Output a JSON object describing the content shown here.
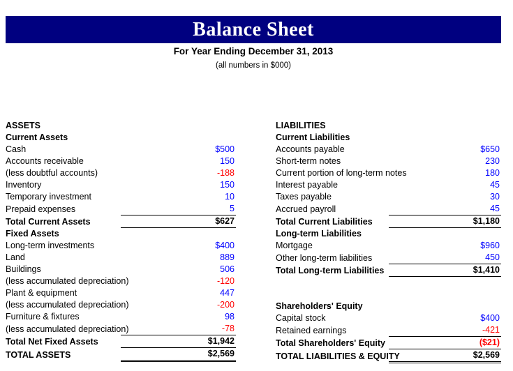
{
  "header": {
    "title": "Balance Sheet",
    "subtitle": "For Year Ending December 31, 2013",
    "units_note": "(all numbers in $000)",
    "banner_color": "#000080",
    "title_color": "#ffffff"
  },
  "colors": {
    "positive_value": "#0000ff",
    "negative_value": "#ff0000",
    "total_value": "#000000",
    "text": "#000000"
  },
  "assets": {
    "heading": "ASSETS",
    "sections": [
      {
        "name": "Current Assets",
        "rows": [
          {
            "label": "Cash",
            "value": "$500",
            "indent": 0,
            "bold": false,
            "color": "blue"
          },
          {
            "label": "Accounts receivable",
            "value": "150",
            "indent": 0,
            "bold": false,
            "color": "blue"
          },
          {
            "label": "(less doubtful accounts)",
            "value": "-188",
            "indent": 1,
            "bold": false,
            "color": "red"
          },
          {
            "label": "Inventory",
            "value": "150",
            "indent": 0,
            "bold": false,
            "color": "blue"
          },
          {
            "label": "Temporary investment",
            "value": "10",
            "indent": 0,
            "bold": false,
            "color": "blue"
          },
          {
            "label": "Prepaid expenses",
            "value": "5",
            "indent": 0,
            "bold": false,
            "color": "blue"
          },
          {
            "label": "Total Current Assets",
            "value": "$627",
            "indent": 2,
            "bold": true,
            "color": "black",
            "rule": "top-bottom"
          }
        ]
      },
      {
        "name": "Fixed Assets",
        "rows": [
          {
            "label": "Long-term investments",
            "value": "$400",
            "indent": 0,
            "bold": false,
            "color": "blue"
          },
          {
            "label": "Land",
            "value": "889",
            "indent": 0,
            "bold": false,
            "color": "blue"
          },
          {
            "label": "Buildings",
            "value": "506",
            "indent": 0,
            "bold": false,
            "color": "blue"
          },
          {
            "label": "(less accumulated depreciation)",
            "value": "-120",
            "indent": 1,
            "bold": false,
            "color": "red"
          },
          {
            "label": "Plant & equipment",
            "value": "447",
            "indent": 0,
            "bold": false,
            "color": "blue"
          },
          {
            "label": "(less accumulated depreciation)",
            "value": "-200",
            "indent": 1,
            "bold": false,
            "color": "red"
          },
          {
            "label": "Furniture & fixtures",
            "value": "98",
            "indent": 0,
            "bold": false,
            "color": "blue"
          },
          {
            "label": "(less accumulated depreciation)",
            "value": "-78",
            "indent": 1,
            "bold": false,
            "color": "red"
          },
          {
            "label": "Total Net Fixed Assets",
            "value": "$1,942",
            "indent": 2,
            "bold": true,
            "color": "black",
            "rule": "top-bottom"
          },
          {
            "label": "TOTAL ASSETS",
            "value": "$2,569",
            "indent": 0,
            "bold": true,
            "color": "black",
            "rule": "double"
          }
        ]
      }
    ]
  },
  "liabilities": {
    "heading": "LIABILITIES",
    "sections": [
      {
        "name": "Current Liabilities",
        "rows": [
          {
            "label": "Accounts payable",
            "value": "$650",
            "indent": 0,
            "bold": false,
            "color": "blue"
          },
          {
            "label": "Short-term notes",
            "value": "230",
            "indent": 0,
            "bold": false,
            "color": "blue"
          },
          {
            "label": "Current portion of long-term notes",
            "value": "180",
            "indent": 0,
            "bold": false,
            "color": "blue"
          },
          {
            "label": "Interest payable",
            "value": "45",
            "indent": 0,
            "bold": false,
            "color": "blue"
          },
          {
            "label": "Taxes payable",
            "value": "30",
            "indent": 0,
            "bold": false,
            "color": "blue"
          },
          {
            "label": "Accrued payroll",
            "value": "45",
            "indent": 0,
            "bold": false,
            "color": "blue"
          },
          {
            "label": "Total Current Liabilities",
            "value": "$1,180",
            "indent": 2,
            "bold": true,
            "color": "black",
            "rule": "top-bottom"
          }
        ]
      },
      {
        "name": "Long-term Liabilities",
        "rows": [
          {
            "label": "Mortgage",
            "value": "$960",
            "indent": 0,
            "bold": false,
            "color": "blue"
          },
          {
            "label": "Other long-term liabilities",
            "value": "450",
            "indent": 0,
            "bold": false,
            "color": "blue"
          },
          {
            "label": "Total Long-term Liabilities",
            "value": "$1,410",
            "indent": 2,
            "bold": true,
            "color": "black",
            "rule": "top-bottom"
          }
        ]
      },
      {
        "name": "Shareholders' Equity",
        "spacer_before": 2,
        "rows": [
          {
            "label": "Capital stock",
            "value": "$400",
            "indent": 0,
            "bold": false,
            "color": "blue"
          },
          {
            "label": "Retained earnings",
            "value": "-421",
            "indent": 0,
            "bold": false,
            "color": "red"
          },
          {
            "label": "Total Shareholders' Equity",
            "value": "($21)",
            "indent": 2,
            "bold": true,
            "color": "red",
            "rule": "top-bottom"
          },
          {
            "label": "TOTAL LIABILITIES & EQUITY",
            "value": "$2,569",
            "indent": 0,
            "bold": true,
            "color": "black",
            "rule": "double"
          }
        ]
      }
    ]
  }
}
